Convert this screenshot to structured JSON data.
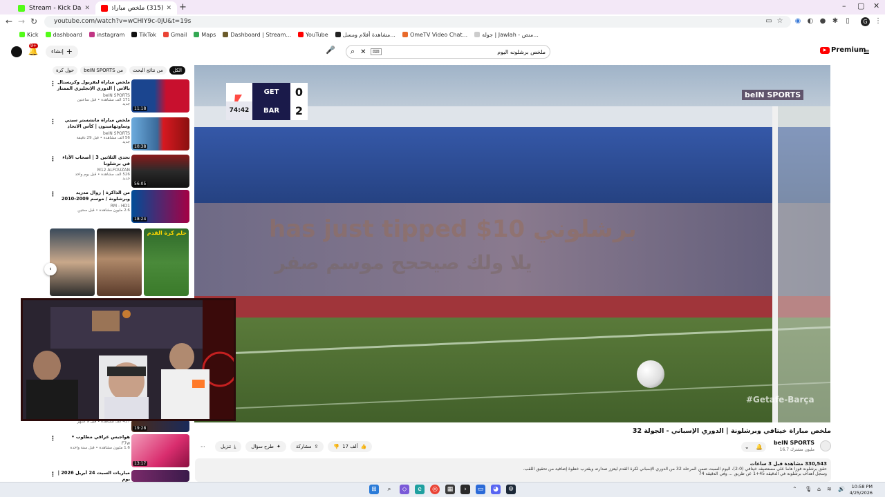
{
  "browser": {
    "tabs": [
      {
        "title": "Stream - Kick Dashboard",
        "active": false,
        "favicon_color": "#53fc18"
      },
      {
        "title": "(315) ملخص مباراة خيتافي وبرشلو...",
        "active": true,
        "favicon_color": "#ff0000"
      }
    ],
    "url": "youtube.com/watch?v=wCHIY9c-0jU&t=19s",
    "profile_initial": "G",
    "bookmarks": [
      {
        "label": "Kick",
        "color": "#53fc18"
      },
      {
        "label": "dashboard",
        "color": "#53fc18"
      },
      {
        "label": "instagram",
        "color": "#c13584"
      },
      {
        "label": "TikTok",
        "color": "#111111"
      },
      {
        "label": "Gmail",
        "color": "#ea4335"
      },
      {
        "label": "Maps",
        "color": "#34a853"
      },
      {
        "label": "Dashboard | Stream...",
        "color": "#6b5b2b"
      },
      {
        "label": "YouTube",
        "color": "#ff0000"
      },
      {
        "label": "مشاهدة أفلام ومسل...",
        "color": "#222222"
      },
      {
        "label": "OmeTV Video Chat...",
        "color": "#e86a2b"
      },
      {
        "label": "جولة | Jawlah - منص...",
        "color": "#cccccc"
      }
    ]
  },
  "youtube": {
    "notification_count": "9+",
    "create_label": "إنشاء",
    "search_query": "ملخص برشلونه اليوم",
    "brand": "Premium",
    "chips": [
      "الكل",
      "من نتائج البحث",
      "من beIN SPORTS",
      "حول كرة"
    ],
    "recommendations": [
      {
        "title": "ملخص مباراة ليفربول وكريستال بالاس | الدوري الإنجليزي الممتاز - الجولة 34",
        "channel": "beIN SPORTS",
        "views": "171 ألف مشاهدة • قبل ساعتين",
        "badge": "جديد",
        "duration": "11:18",
        "thumb_colors": [
          "#c8102e",
          "#1b458f"
        ]
      },
      {
        "title": "ملخص مباراة مانشستر سيتي وساوثهامبتون | كأس الاتحاد الإنجليزي - الدور نصف النهائي",
        "channel": "beIN SPORTS",
        "views": "56 ألف مشاهدة • قبل 29 دقيقة",
        "badge": "جديد",
        "duration": "10:38",
        "thumb_colors": [
          "#6cabdd",
          "#d71920"
        ]
      },
      {
        "title": "تحدي الثلاثين 3 | أصحاب الأداء في برشلونا",
        "channel": "M12 ALFOUZAN",
        "views": "526 ألف مشاهدة • قبل يوم واحد",
        "badge": "جديد",
        "duration": "56:05",
        "thumb_colors": [
          "#2a2a2a",
          "#8a1a1a"
        ]
      },
      {
        "title": "من الذاكرة | زوال مدريد وبرشلونة / موسم 2009-2010 تعليق عصام الشوالي جودة ...",
        "channel": "RM - HD1",
        "views": "2.6 مليون مشاهدة • قبل سنتين",
        "badge": "",
        "duration": "18:24",
        "thumb_colors": [
          "#004d98",
          "#a50044"
        ]
      }
    ],
    "partial_recommendation": {
      "views": "437 ألف مشاهدة • قبل 9 أشهر",
      "duration": "19:28"
    },
    "recommendations_lower": [
      {
        "title": "هواجيس عراقي مطلوب •",
        "channel": "F7w",
        "views": "1.6 مليون مشاهدة • قبل سنة واحدة",
        "duration": "13:17",
        "thumb_colors": [
          "#d92d6e",
          "#f29bb9"
        ]
      },
      {
        "title": "مباريات السبت 24 أبريل 2026 | يوم",
        "channel": "",
        "views": "",
        "duration": "",
        "thumb_colors": [
          "#3a1a4a",
          "#7a2a6a"
        ]
      }
    ],
    "shorts_title": "حلم كرة القدم",
    "video": {
      "title": "ملخص مباراة خيتافي وبرشلونة | الدوري الإسباني - الجولة 32",
      "channel": "beIN SPORTS",
      "subscribers": "16.7 مليون مشترك",
      "likes": "17 ألف",
      "share_label": "مشاركة",
      "ask_label": "طرح سؤال",
      "download_label": "تنزيل",
      "views_line": "330,543 مشاهدة قبل 3 ساعات",
      "description_1": "حقق برشلونة فوزاً هاماً على مستضيفه خيتافي (0-2)، اليوم السبت ضمن المرحلة 32 من الدوري الإسباني لكرة القدم ليعزز صدارته ويقترب خطوة إضافية من تحقيق اللقب.",
      "description_2": "وسجل أهداف برشلونة في الدقيقة 45+1 عن طريق ... وفي الدقيقة 74"
    },
    "scoreboard": {
      "home": "GET",
      "away": "BAR",
      "home_score": "0",
      "away_score": "2",
      "clock": "74:42"
    },
    "broadcaster_logo": "beIN SPORTS",
    "overlay_tip": "برشلوني has just tipped $10",
    "overlay_msg": "يلا ولك صيححح موسم صفر",
    "hashtag": "#Getafe-Barça"
  },
  "taskbar": {
    "time": "10:58 PM",
    "date": "4/25/2026"
  }
}
